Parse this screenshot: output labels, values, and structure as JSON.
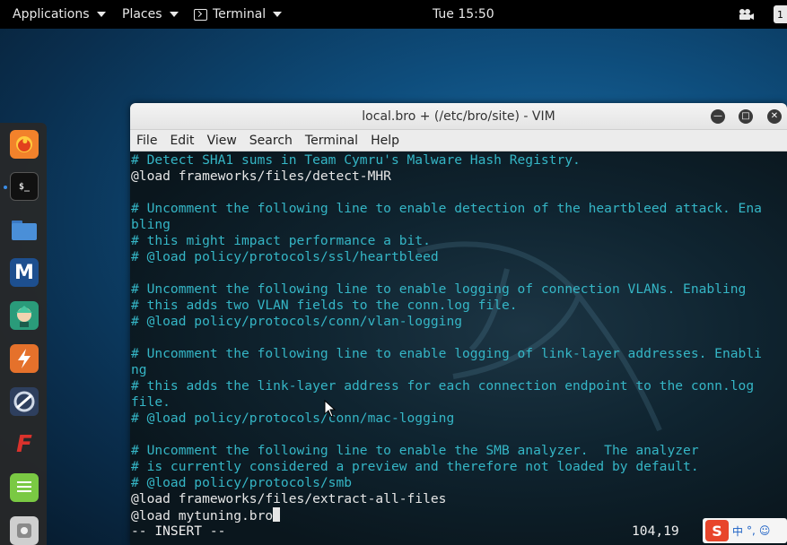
{
  "topbar": {
    "applications_label": "Applications",
    "places_label": "Places",
    "terminal_label": "Terminal",
    "clock": "Tue 15:50",
    "right_indicator": "1"
  },
  "dock": {
    "items": [
      {
        "icon": "firefox-icon",
        "color": "#f2822b"
      },
      {
        "icon": "terminal-icon",
        "color": "#111111"
      },
      {
        "icon": "files-icon",
        "color": "#4a8fd8"
      },
      {
        "icon": "metasploit-icon",
        "color": "#1d4f8f"
      },
      {
        "icon": "armitage-icon",
        "color": "#2a9b7a"
      },
      {
        "icon": "burpsuite-icon",
        "color": "#e5712b"
      },
      {
        "icon": "maltego-icon",
        "color": "#2e3f5e"
      },
      {
        "icon": "faraday-icon",
        "color": "#d9322c"
      },
      {
        "icon": "leafpad-icon",
        "color": "#7ac943"
      },
      {
        "icon": "settings-icon",
        "color": "#cfcfcf"
      }
    ]
  },
  "window": {
    "title": "local.bro + (/etc/bro/site) - VIM",
    "menu": [
      "File",
      "Edit",
      "View",
      "Search",
      "Terminal",
      "Help"
    ]
  },
  "editor": {
    "lines": [
      {
        "text": "# Detect SHA1 sums in Team Cymru's Malware Hash Registry.",
        "comment": true
      },
      {
        "text": "@load frameworks/files/detect-MHR",
        "comment": false
      },
      {
        "text": "",
        "comment": false
      },
      {
        "text": "# Uncomment the following line to enable detection of the heartbleed attack. Ena",
        "comment": true
      },
      {
        "text": "bling",
        "comment": true
      },
      {
        "text": "# this might impact performance a bit.",
        "comment": true
      },
      {
        "text": "# @load policy/protocols/ssl/heartbleed",
        "comment": true
      },
      {
        "text": "",
        "comment": false
      },
      {
        "text": "# Uncomment the following line to enable logging of connection VLANs. Enabling",
        "comment": true
      },
      {
        "text": "# this adds two VLAN fields to the conn.log file.",
        "comment": true
      },
      {
        "text": "# @load policy/protocols/conn/vlan-logging",
        "comment": true
      },
      {
        "text": "",
        "comment": false
      },
      {
        "text": "# Uncomment the following line to enable logging of link-layer addresses. Enabli",
        "comment": true
      },
      {
        "text": "ng",
        "comment": true
      },
      {
        "text": "# this adds the link-layer address for each connection endpoint to the conn.log",
        "comment": true
      },
      {
        "text": "file.",
        "comment": true
      },
      {
        "text": "# @load policy/protocols/conn/mac-logging",
        "comment": true
      },
      {
        "text": "",
        "comment": false
      },
      {
        "text": "# Uncomment the following line to enable the SMB analyzer.  The analyzer",
        "comment": true
      },
      {
        "text": "# is currently considered a preview and therefore not loaded by default.",
        "comment": true
      },
      {
        "text": "# @load policy/protocols/smb",
        "comment": true
      },
      {
        "text": "@load frameworks/files/extract-all-files",
        "comment": false
      },
      {
        "text": "@load mytuning.bro",
        "comment": false
      }
    ],
    "mode": "-- INSERT --",
    "position": "104,19"
  },
  "ime": {
    "logo": "S",
    "chinese": "中",
    "punct": "°,",
    "emoji": "☺"
  }
}
